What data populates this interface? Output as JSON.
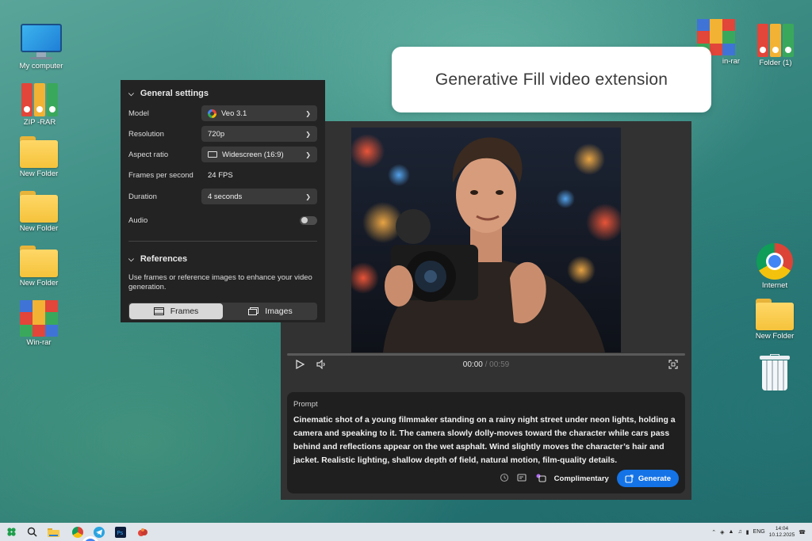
{
  "desktop_left": [
    {
      "label": "My computer",
      "icon": "monitor-icon"
    },
    {
      "label": "ZIP -RAR",
      "icon": "binders-icon"
    },
    {
      "label": "New Folder",
      "icon": "folder-icon"
    },
    {
      "label": "New Folder",
      "icon": "folder-icon"
    },
    {
      "label": "New Folder",
      "icon": "folder-icon"
    },
    {
      "label": "Win-rar",
      "icon": "winrar-icon"
    }
  ],
  "desktop_right": [
    {
      "label": "in-rar",
      "icon": "winrar-icon"
    },
    {
      "label": "Folder (1)",
      "icon": "binders-icon"
    },
    {
      "label": "Internet",
      "icon": "chrome-icon"
    },
    {
      "label": "New Folder",
      "icon": "folder-icon"
    },
    {
      "label": "",
      "icon": "recycle-bin-icon"
    }
  ],
  "title_card": {
    "text": "Generative Fill video extension"
  },
  "settings": {
    "general_heading": "General settings",
    "model_label": "Model",
    "model_value": "Veo 3.1",
    "resolution_label": "Resolution",
    "resolution_value": "720p",
    "aspect_label": "Aspect ratio",
    "aspect_value": "Widescreen (16:9)",
    "fps_label": "Frames per second",
    "fps_value": "24 FPS",
    "duration_label": "Duration",
    "duration_value": "4 seconds",
    "audio_label": "Audio",
    "audio_on": false,
    "references_heading": "References",
    "references_desc": "Use frames or reference images to enhance your video generation.",
    "frames_tab": "Frames",
    "images_tab": "Images"
  },
  "player": {
    "current_time": "00:00",
    "duration": "00:59",
    "progress": 0
  },
  "prompt": {
    "label": "Prompt",
    "text": "Cinematic shot of a young filmmaker standing on a rainy night street under neon lights, holding a camera and speaking to it. The camera slowly dolly-moves toward the character while cars pass behind and reflections appear on the wet asphalt. Wind slightly moves the character’s hair and jacket. Realistic lighting, shallow depth of field, natural motion, film-quality details.",
    "complimentary_label": "Complimentary",
    "generate_label": "Generate"
  },
  "taskbar": {
    "language": "ENG",
    "time": "14:04",
    "date": "10.12.2025"
  },
  "colors": {
    "accent": "#1473e6",
    "panel": "#232323",
    "video_panel": "#323232"
  }
}
